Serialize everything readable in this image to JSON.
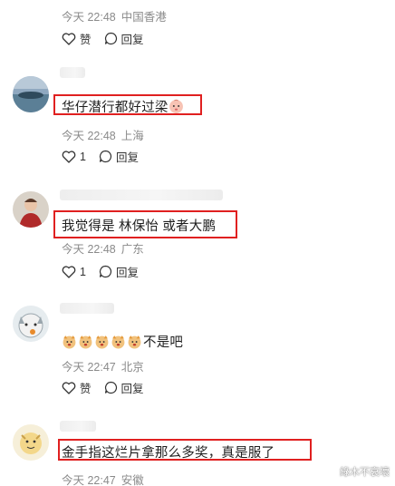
{
  "comments": [
    {
      "text": "",
      "time": "今天 22:48",
      "location": "中国香港",
      "actions": {
        "like": "赞",
        "reply": "回复"
      }
    },
    {
      "text": "华仔潜行都好过梁",
      "time": "今天 22:48",
      "location": "上海",
      "actions": {
        "like": "1",
        "reply": "回复"
      }
    },
    {
      "text": "我觉得是 林保怡 或者大鹏",
      "time": "今天 22:48",
      "location": "广东",
      "actions": {
        "like": "1",
        "reply": "回复"
      }
    },
    {
      "text": "不是吧",
      "time": "今天 22:47",
      "location": "北京",
      "actions": {
        "like": "赞",
        "reply": "回复"
      }
    },
    {
      "text": "金手指这烂片拿那么多奖，真是服了",
      "time": "今天 22:47",
      "location": "安徽",
      "actions": {
        "like": "",
        "reply": ""
      }
    }
  ],
  "watermark": "綠木不衰壞",
  "colors": {
    "highlight": "#e02020",
    "meta": "#8a8a8a"
  }
}
